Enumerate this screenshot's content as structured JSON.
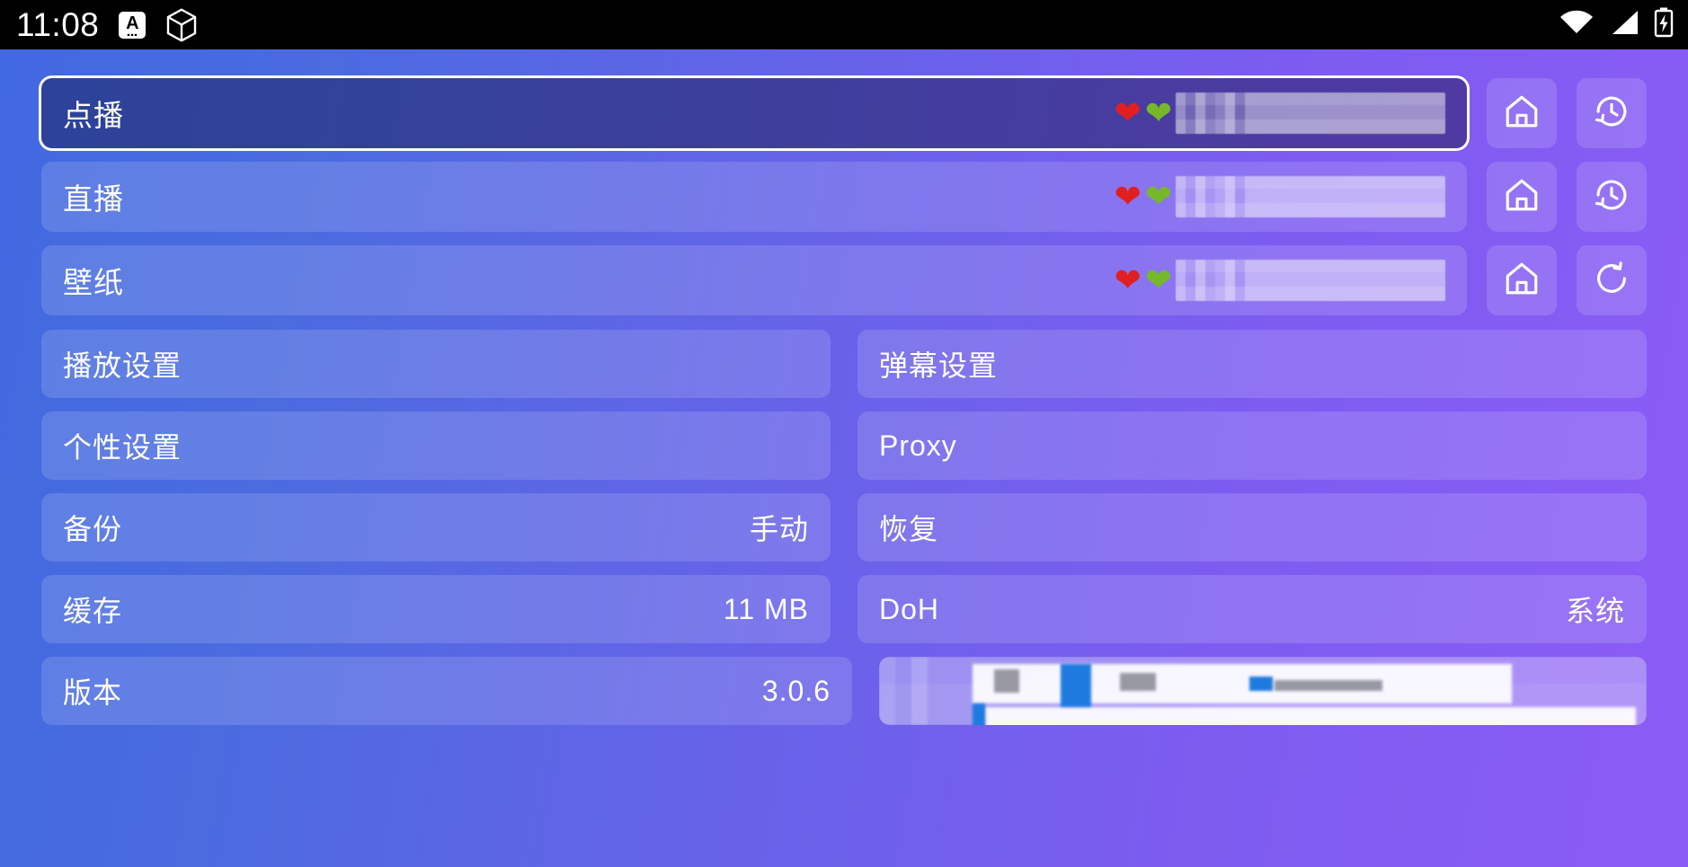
{
  "statusbar": {
    "clock": "11:08",
    "badge_letter": "A",
    "icons": [
      "app-badge-icon",
      "cube-icon",
      "wifi-icon",
      "signal-icon",
      "battery-charging-icon"
    ]
  },
  "theme": {
    "gradient_start": "#4169e1",
    "gradient_end": "#8b5cf6",
    "tile_bg": "rgba(255,255,255,0.14)",
    "focus_outline": "#ffffff",
    "text": "#ffffff",
    "heart_red": "#e02020",
    "heart_green": "#76b82a"
  },
  "top_rows": [
    {
      "title": "点播",
      "hearts": [
        "❤",
        "❤"
      ],
      "source_name": "",
      "focused": true,
      "home_icon": "home-icon",
      "action_icon": "history-icon"
    },
    {
      "title": "直播",
      "hearts": [
        "❤",
        "❤"
      ],
      "source_name": "",
      "focused": false,
      "home_icon": "home-icon",
      "action_icon": "history-icon"
    },
    {
      "title": "壁纸",
      "hearts": [
        "❤",
        "❤"
      ],
      "source_name": "",
      "focused": false,
      "home_icon": "home-icon",
      "action_icon": "refresh-icon"
    }
  ],
  "grid_rows": [
    {
      "left": {
        "label": "播放设置",
        "value": ""
      },
      "right": {
        "label": "弹幕设置",
        "value": ""
      }
    },
    {
      "left": {
        "label": "个性设置",
        "value": ""
      },
      "right": {
        "label": "Proxy",
        "value": ""
      }
    },
    {
      "left": {
        "label": "备份",
        "value": "手动"
      },
      "right": {
        "label": "恢复",
        "value": ""
      }
    },
    {
      "left": {
        "label": "缓存",
        "value": "11 MB"
      },
      "right": {
        "label": "DoH",
        "value": "系统"
      }
    },
    {
      "left": {
        "label": "版本",
        "value": "3.0.6"
      },
      "right": {
        "label": "",
        "value": "",
        "censored": true
      }
    }
  ]
}
